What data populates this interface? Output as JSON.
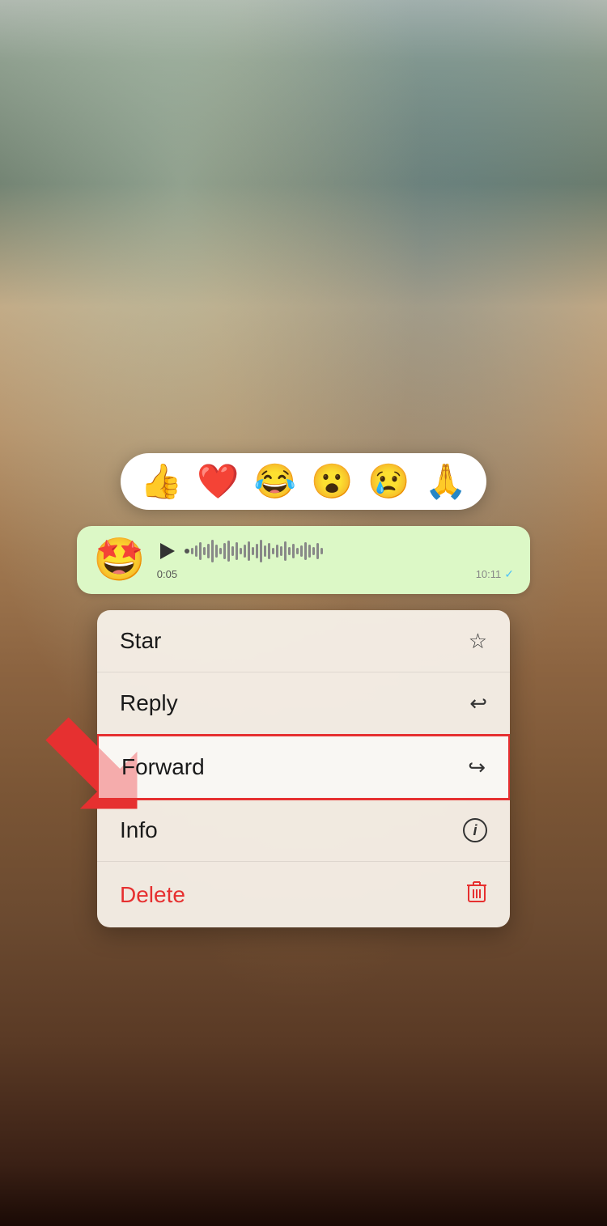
{
  "background": {
    "description": "Blurred room/living area background"
  },
  "emoji_bar": {
    "emojis": [
      "👍",
      "❤️",
      "😂",
      "😮",
      "😢",
      "🙏"
    ]
  },
  "message_bubble": {
    "sender_emoji": "🤩",
    "duration_current": "0:05",
    "duration_total": "10:11",
    "checkmark": "✓"
  },
  "context_menu": {
    "items": [
      {
        "label": "Star",
        "icon": "☆",
        "id": "star",
        "delete": false,
        "forward": false
      },
      {
        "label": "Reply",
        "icon": "↩",
        "id": "reply",
        "delete": false,
        "forward": false
      },
      {
        "label": "Forward",
        "icon": "↪",
        "id": "forward",
        "delete": false,
        "forward": true
      },
      {
        "label": "Info",
        "icon": "ℹ",
        "id": "info",
        "delete": false,
        "forward": false
      },
      {
        "label": "Delete",
        "icon": "🗑",
        "id": "delete",
        "delete": true,
        "forward": false
      }
    ]
  },
  "arrow": {
    "color": "#e63030"
  }
}
